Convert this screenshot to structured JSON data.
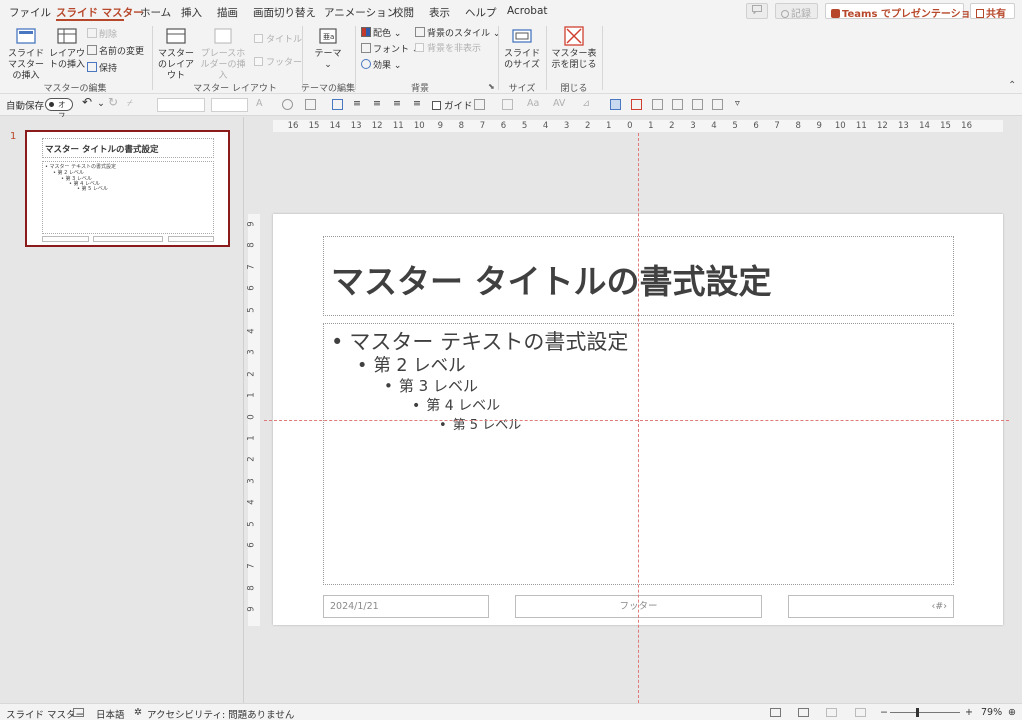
{
  "menu_tabs": [
    {
      "label": "ファイル"
    },
    {
      "label": "スライド マスター",
      "active": true
    },
    {
      "label": "ホーム"
    },
    {
      "label": "挿入"
    },
    {
      "label": "描画"
    },
    {
      "label": "画面切り替え"
    },
    {
      "label": "アニメーション"
    },
    {
      "label": "校閲"
    },
    {
      "label": "表示"
    },
    {
      "label": "ヘルプ"
    },
    {
      "label": "Acrobat"
    }
  ],
  "top_right": {
    "comment_icon": "comment-icon",
    "record_label": "記録",
    "teams_label": "Teams でプレゼンテーション",
    "share_label": "共有"
  },
  "ribbon": {
    "master_edit": {
      "insert_master": "スライド マスターの挿入",
      "insert_layout": "レイアウトの挿入",
      "delete": "削除",
      "rename": "名前の変更",
      "preserve": "保持",
      "group_label": "マスターの編集"
    },
    "master_layout": {
      "master_layout": "マスターのレイアウト",
      "insert_placeholder": "プレースホルダーの挿入",
      "title_check": "タイトル",
      "footer_check": "フッター",
      "group_label": "マスター レイアウト"
    },
    "theme_edit": {
      "theme": "テーマ",
      "group_label": "テーマの編集"
    },
    "background": {
      "colors": "配色",
      "fonts": "フォント",
      "effects": "効果",
      "bg_styles": "背景のスタイル",
      "hide_bg": "背景を非表示",
      "group_label": "背景"
    },
    "size": {
      "slide_size": "スライドのサイズ",
      "group_label": "サイズ"
    },
    "close": {
      "close_master": "マスター表示を閉じる",
      "group_label": "閉じる"
    }
  },
  "qat": {
    "autosave_label": "自動保存",
    "autosave_state": "オフ",
    "guide_label": "ガイド"
  },
  "thumbnail": {
    "number": "1",
    "title": "マスター タイトルの書式設定",
    "lines": [
      "• マスター テキストの書式設定",
      "• 第 2 レベル",
      "• 第 3 レベル",
      "• 第 4 レベル",
      "• 第 5 レベル"
    ]
  },
  "ruler": {
    "h_labels": [
      "16",
      "15",
      "14",
      "13",
      "12",
      "11",
      "10",
      "9",
      "8",
      "7",
      "6",
      "5",
      "4",
      "3",
      "2",
      "1",
      "0",
      "1",
      "2",
      "3",
      "4",
      "5",
      "6",
      "7",
      "8",
      "9",
      "10",
      "11",
      "12",
      "13",
      "14",
      "15",
      "16"
    ],
    "v_labels": [
      "9",
      "8",
      "7",
      "6",
      "5",
      "4",
      "3",
      "2",
      "1",
      "0",
      "1",
      "2",
      "3",
      "4",
      "5",
      "6",
      "7",
      "8",
      "9"
    ]
  },
  "slide": {
    "title": "マスター タイトルの書式設定",
    "levels": [
      "マスター テキストの書式設定",
      "第 2 レベル",
      "第 3 レベル",
      "第 4 レベル",
      "第 5 レベル"
    ],
    "date": "2024/1/21",
    "footer": "フッター",
    "page_number": "‹#›"
  },
  "status": {
    "view_name": "スライド マスター",
    "language": "日本語",
    "accessibility": "アクセシビリティ: 問題ありません",
    "zoom": "79%"
  },
  "colors": {
    "accent": "#b7472a",
    "selection_border": "#8b1a1a",
    "guide": "#e07a7a"
  }
}
